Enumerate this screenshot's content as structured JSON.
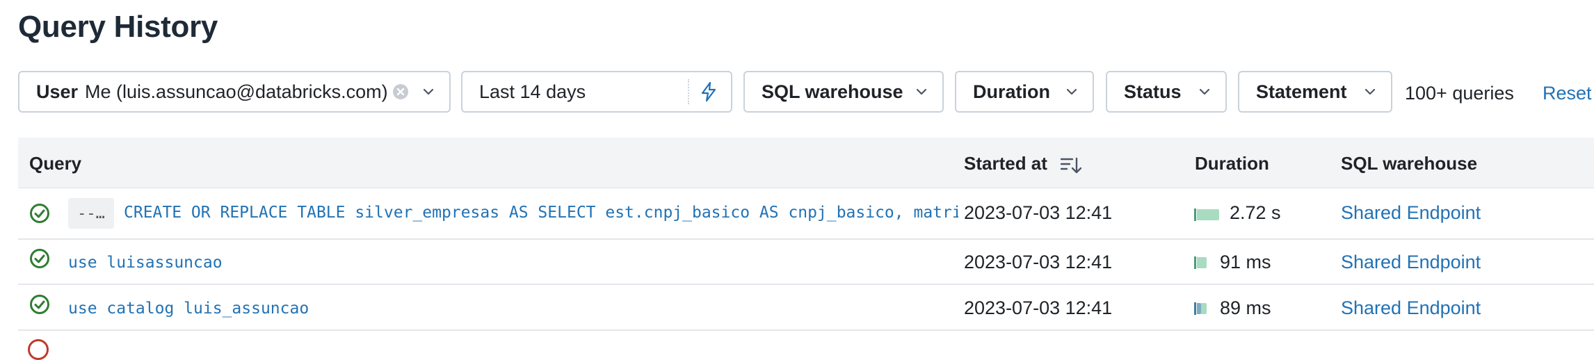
{
  "page": {
    "title": "Query History"
  },
  "filters": {
    "user": {
      "label": "User",
      "value": "Me (luis.assuncao@databricks.com)"
    },
    "date_range": {
      "value": "Last 14 days"
    },
    "warehouse": {
      "label": "SQL warehouse"
    },
    "duration": {
      "label": "Duration"
    },
    "status": {
      "label": "Status"
    },
    "statement": {
      "label": "Statement"
    },
    "count_text": "100+ queries",
    "reset_label": "Reset"
  },
  "table": {
    "columns": [
      "Query",
      "Started at",
      "Duration",
      "SQL warehouse"
    ],
    "rows": [
      {
        "status": "success",
        "prefix": "--…",
        "query": "CREATE OR REPLACE TABLE silver_empresas AS SELECT est.cnpj_basico AS cnpj_basico, matri…",
        "started_at": "2023-07-03 12:41",
        "duration": "2.72 s",
        "warehouse": "Shared Endpoint"
      },
      {
        "status": "success",
        "query": "use luisassuncao",
        "started_at": "2023-07-03 12:41",
        "duration": "91 ms",
        "warehouse": "Shared Endpoint"
      },
      {
        "status": "success",
        "query": "use catalog luis_assuncao",
        "started_at": "2023-07-03 12:41",
        "duration": "89 ms",
        "warehouse": "Shared Endpoint"
      }
    ]
  },
  "colors": {
    "accent": "#2272b4",
    "success": "#2e7d32",
    "duration_fill": "#a8dcc0",
    "error": "#c0392b"
  },
  "icons": {
    "status": "check-circle-icon",
    "sort": "sort-descending-icon",
    "clear": "clear-circle-icon",
    "chevron": "chevron-down-icon",
    "refresh": "lightning-bolt-icon"
  }
}
